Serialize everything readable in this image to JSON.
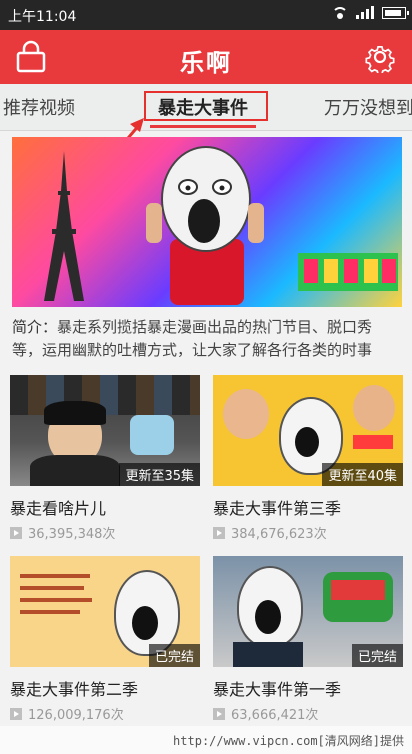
{
  "status_bar": {
    "time": "上午11:04"
  },
  "header": {
    "title": "乐啊"
  },
  "tabs": [
    {
      "label": "推荐视频"
    },
    {
      "label": "暴走大事件"
    },
    {
      "label": "万万没想到"
    }
  ],
  "banner": {
    "intro_label": "简介：",
    "intro_text": "暴走系列揽括暴走漫画出品的热门节目、脱口秀等，运用幽默的吐槽方式，让大家了解各行各类的时事"
  },
  "cards": [
    {
      "title": "暴走看啥片儿",
      "count": "36,395,348次",
      "badge": "更新至35集"
    },
    {
      "title": "暴走大事件第三季",
      "count": "384,676,623次",
      "badge": "更新至40集"
    },
    {
      "title": "暴走大事件第二季",
      "count": "126,009,176次",
      "badge": "已完结"
    },
    {
      "title": "暴走大事件第一季",
      "count": "63,666,421次",
      "badge": "已完结"
    }
  ],
  "watermark": "http://www.vipcn.com[清风网络]提供",
  "colors": {
    "accent": "#e8393d",
    "highlight_box": "#e5302e"
  }
}
